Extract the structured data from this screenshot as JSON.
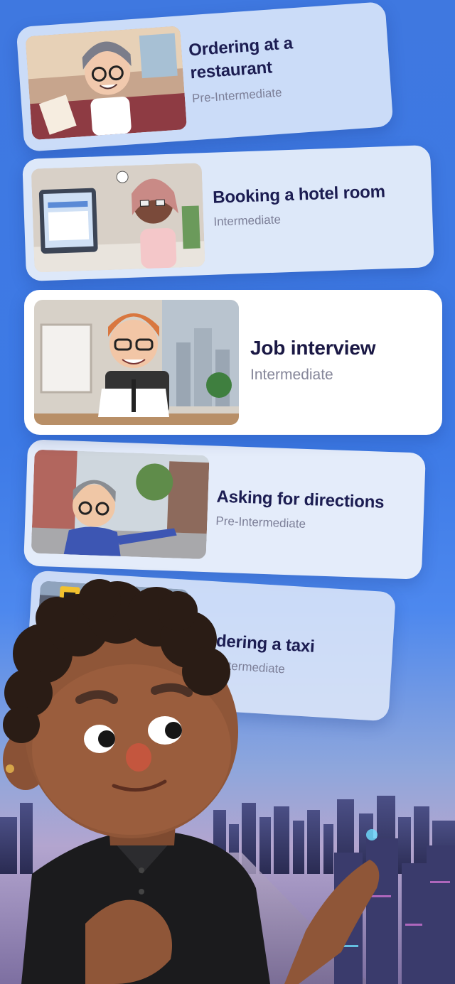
{
  "lessons": [
    {
      "title": "Ordering at a restaurant",
      "level": "Pre-Intermediate",
      "icon": "restaurant-scene-image"
    },
    {
      "title": "Booking a hotel room",
      "level": "Intermediate",
      "icon": "hotel-scene-image"
    },
    {
      "title": "Job interview",
      "level": "Intermediate",
      "icon": "interview-scene-image"
    },
    {
      "title": "Asking for directions",
      "level": "Pre-Intermediate",
      "icon": "street-scene-image"
    },
    {
      "title": "Ordering a taxi",
      "level": "Pre-Intermediate",
      "icon": "taxi-scene-image"
    }
  ],
  "hero_character": "tutor-avatar-illustration",
  "background": "city-skyline-illustration"
}
